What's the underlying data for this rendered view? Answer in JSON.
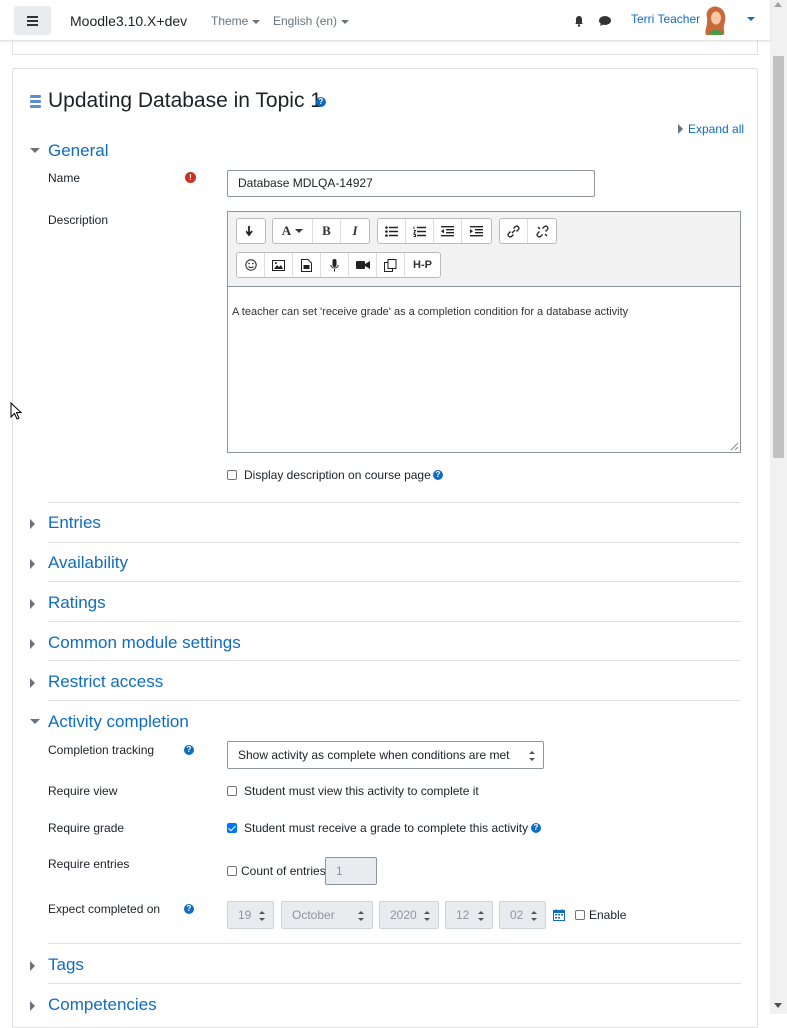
{
  "navbar": {
    "brand": "Moodle3.10.X+dev",
    "theme_label": "Theme",
    "language_label": "English (en)",
    "user_name": "Terri Teacher"
  },
  "page": {
    "title": "Updating Database in Topic 1",
    "expand_all": "Expand all"
  },
  "general": {
    "header": "General",
    "name_label": "Name",
    "name_value": "Database MDLQA-14927",
    "description_label": "Description",
    "description_text": "A teacher can set 'receive grade' as a completion condition for a database activity",
    "display_desc_label": "Display description on course page"
  },
  "editor_toolbar": {
    "bold": "B",
    "italic": "I",
    "font": "A",
    "h5p": "H-P"
  },
  "sections": {
    "entries": "Entries",
    "availability": "Availability",
    "ratings": "Ratings",
    "common": "Common module settings",
    "restrict": "Restrict access",
    "tags": "Tags",
    "competencies": "Competencies"
  },
  "completion": {
    "header": "Activity completion",
    "tracking_label": "Completion tracking",
    "tracking_value": "Show activity as complete when conditions are met",
    "require_view_label": "Require view",
    "require_view_text": "Student must view this activity to complete it",
    "require_view_checked": false,
    "require_grade_label": "Require grade",
    "require_grade_text": "Student must receive a grade to complete this activity",
    "require_grade_checked": true,
    "require_entries_label": "Require entries",
    "count_entries_text": "Count of entries",
    "count_entries_value": "1",
    "expect_label": "Expect completed on",
    "day": "19",
    "month": "October",
    "year": "2020",
    "hour": "12",
    "minute": "02",
    "enable_label": "Enable"
  }
}
